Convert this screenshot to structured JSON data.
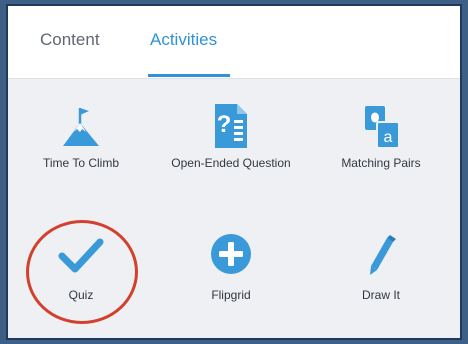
{
  "tabs": [
    {
      "label": "Content"
    },
    {
      "label": "Activities"
    }
  ],
  "activities": [
    {
      "label": "Time To Climb",
      "icon": "mountain-flag-icon"
    },
    {
      "label": "Open-Ended Question",
      "icon": "question-doc-icon"
    },
    {
      "label": "Matching Pairs",
      "icon": "matching-cards-icon"
    },
    {
      "label": "Quiz",
      "icon": "checkmark-icon"
    },
    {
      "label": "Flipgrid",
      "icon": "plus-circle-icon"
    },
    {
      "label": "Draw It",
      "icon": "pencil-icon"
    }
  ],
  "colors": {
    "accent": "#2f93d6",
    "highlight": "#d2402e"
  }
}
